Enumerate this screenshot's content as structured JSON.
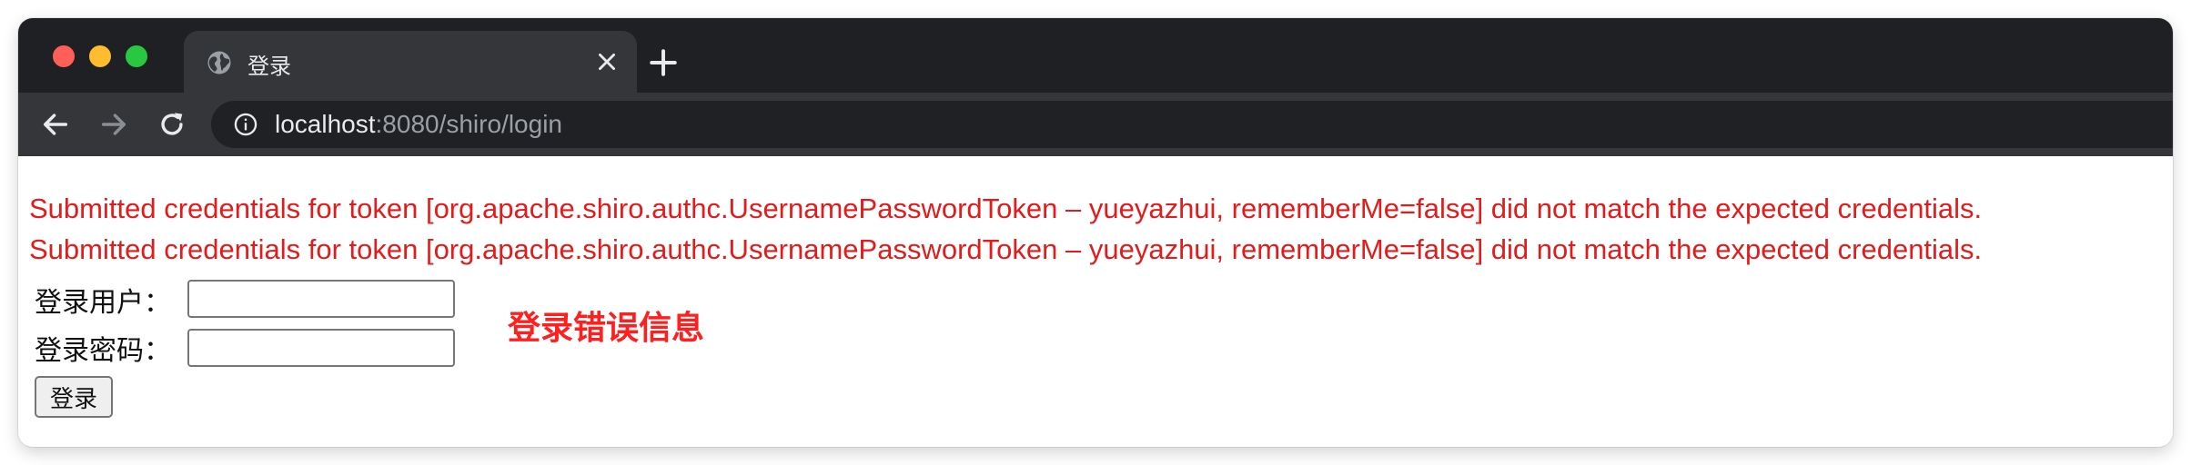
{
  "browser": {
    "tab": {
      "title": "登录",
      "favicon": "globe-icon",
      "close_icon": "close-icon"
    },
    "new_tab_icon": "plus-icon",
    "nav": {
      "back_icon": "arrow-left-icon",
      "forward_icon": "arrow-right-icon",
      "reload_icon": "reload-icon"
    },
    "address": {
      "info_icon": "info-icon",
      "host": "localhost",
      "rest": ":8080/shiro/login"
    }
  },
  "page": {
    "errors": [
      "Submitted credentials for token [org.apache.shiro.authc.UsernamePasswordToken – yueyazhui, rememberMe=false] did not match the expected credentials.",
      "Submitted credentials for token [org.apache.shiro.authc.UsernamePasswordToken – yueyazhui, rememberMe=false] did not match the expected credentials."
    ],
    "form": {
      "username_label": "登录用户：",
      "username_value": "",
      "password_label": "登录密码：",
      "password_value": "",
      "submit_label": "登录"
    },
    "annotation": "登录错误信息"
  },
  "colors": {
    "error_text": "#e31b1b",
    "annotation_text": "#ff1f1f",
    "tabbar_bg": "#1f2023",
    "toolbar_bg": "#35363a"
  }
}
